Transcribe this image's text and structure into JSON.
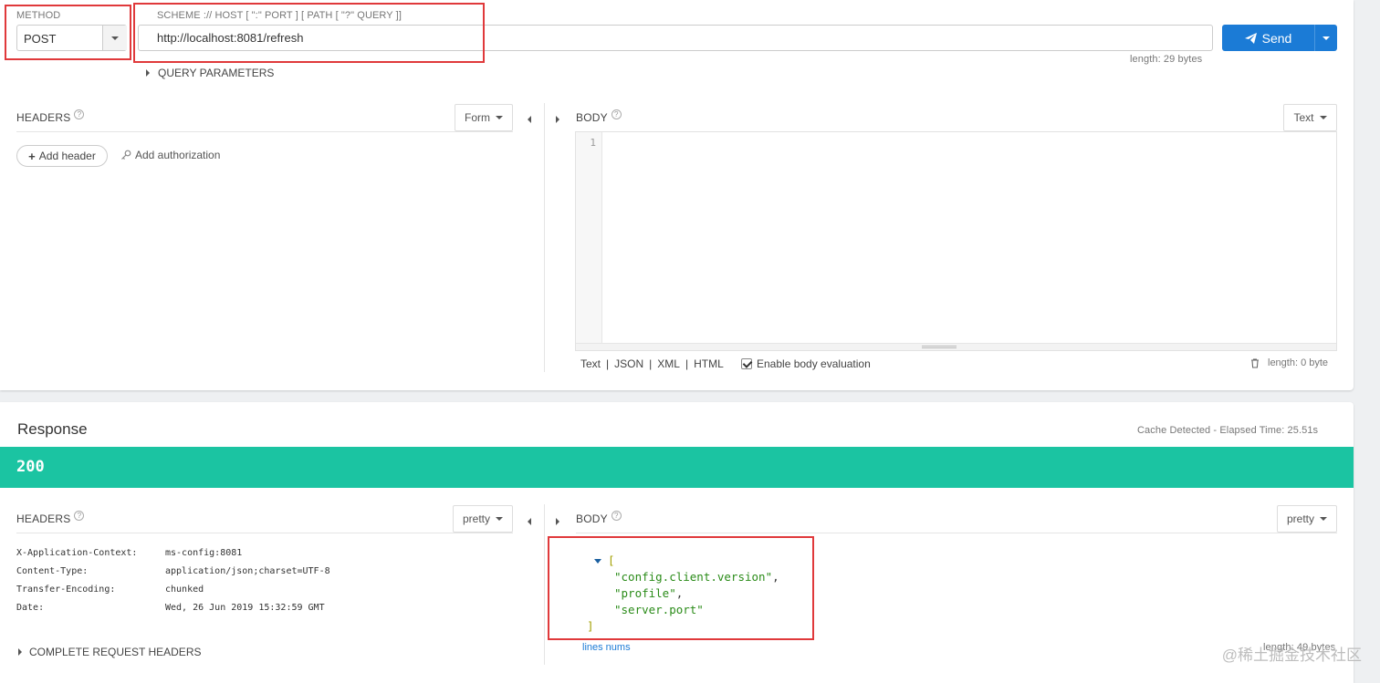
{
  "request": {
    "method": {
      "label": "METHOD",
      "value": "POST"
    },
    "url": {
      "label": "SCHEME :// HOST [ \":\" PORT ] [ PATH [ \"?\" QUERY ]]",
      "value": "http://localhost:8081/refresh",
      "length": "length: 29 bytes"
    },
    "send_label": "Send",
    "query_params_label": "QUERY PARAMETERS",
    "headers": {
      "title": "HEADERS",
      "mode": "Form",
      "add_header": "Add header",
      "add_auth": "Add authorization"
    },
    "body": {
      "title": "BODY",
      "mode": "Text",
      "line_number": "1",
      "formats": [
        "Text",
        "|",
        "JSON",
        "|",
        "XML",
        "|",
        "HTML"
      ],
      "enable_eval_label": "Enable body evaluation",
      "length": "length: 0 byte"
    }
  },
  "response": {
    "title": "Response",
    "cache_info": "Cache Detected - Elapsed Time: 25.51s",
    "status": "200",
    "headers": {
      "title": "HEADERS",
      "mode": "pretty",
      "rows": [
        {
          "key": "X-Application-Context:",
          "value": "ms-config:8081"
        },
        {
          "key": "Content-Type:",
          "value": "application/json;charset=UTF-8"
        },
        {
          "key": "Transfer-Encoding:",
          "value": "chunked"
        },
        {
          "key": "Date:",
          "value": "Wed, 26 Jun 2019 15:32:59 GMT"
        }
      ],
      "complete_label": "COMPLETE REQUEST HEADERS"
    },
    "body": {
      "title": "BODY",
      "mode": "pretty",
      "open_bracket": "[",
      "items": [
        "\"config.client.version\"",
        "\"profile\"",
        "\"server.port\""
      ],
      "close_bracket": "]",
      "lines_nums": "lines nums",
      "length": "length: 49 bytes"
    }
  },
  "watermark": "@稀土掘金技术社区",
  "colors": {
    "accent": "#1b7bd6",
    "status_ok": "#1bc4a2",
    "highlight_border": "#e0393b",
    "json_string": "#2a8b18"
  }
}
